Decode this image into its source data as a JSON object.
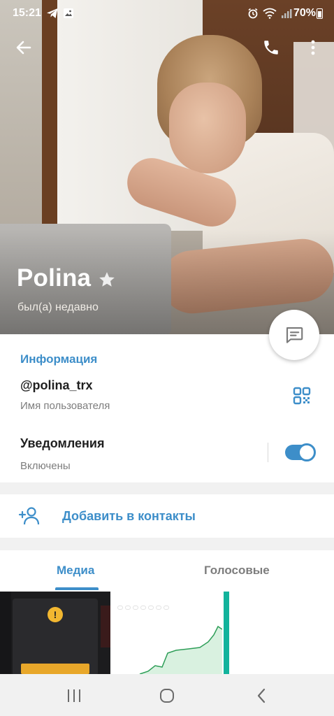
{
  "status_bar": {
    "time": "15:21",
    "battery": "70%"
  },
  "profile": {
    "name": "Polina",
    "last_seen": "был(а) недавно"
  },
  "info": {
    "section_title": "Информация",
    "username": "@polina_trx",
    "username_label": "Имя пользователя",
    "notifications_title": "Уведомления",
    "notifications_state": "Включены",
    "notifications_enabled": true
  },
  "actions": {
    "add_contact": "Добавить в контакты"
  },
  "tabs": [
    {
      "label": "Медиа",
      "active": true
    },
    {
      "label": "Голосовые",
      "active": false
    }
  ],
  "colors": {
    "accent": "#3d8ec9",
    "toggle_on": "#3d8ec9"
  }
}
